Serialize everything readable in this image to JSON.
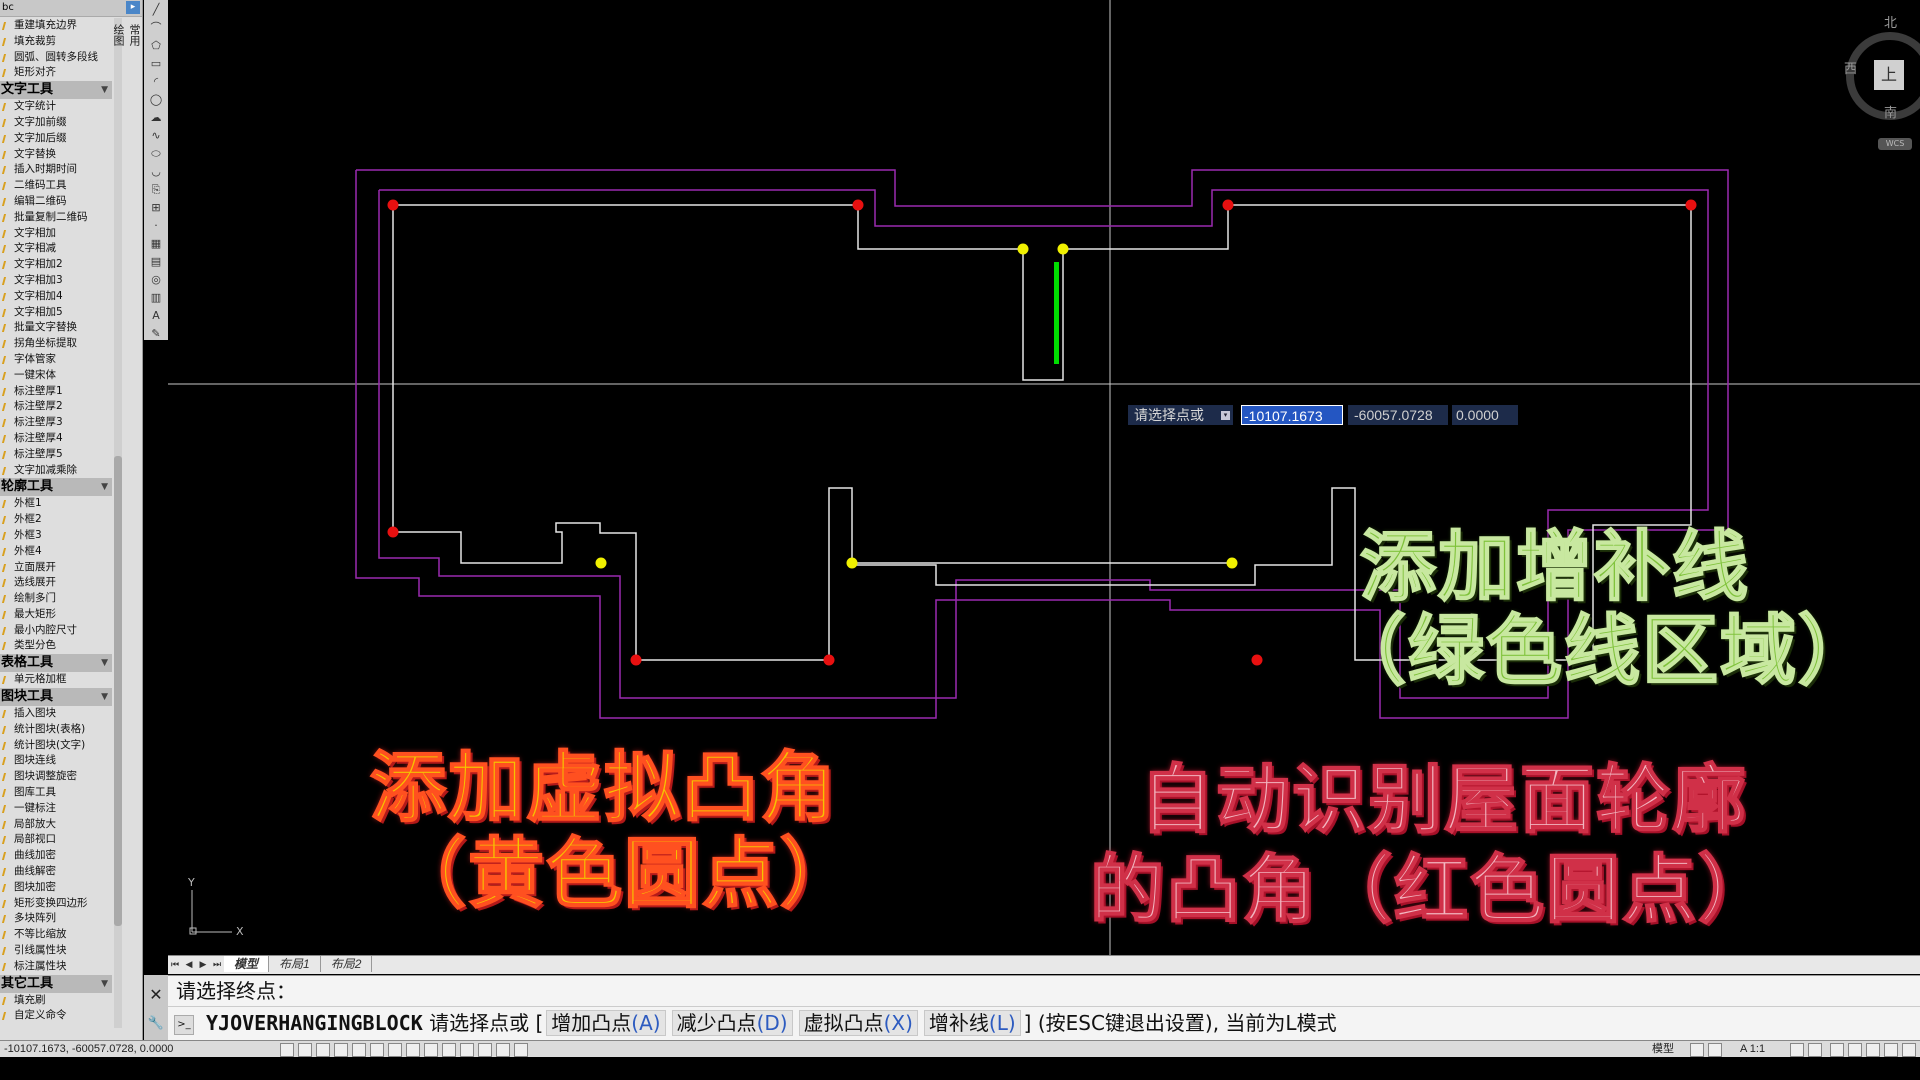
{
  "palette": {
    "top_label": "bc",
    "tabs": [
      "常用",
      "绘图"
    ],
    "groups": [
      {
        "header": null,
        "items": [
          "重建填充边界",
          "填充裁剪",
          "圆弧、圆转多段线",
          "矩形对齐"
        ]
      },
      {
        "header": "文字工具",
        "items": [
          "文字统计",
          "文字加前缀",
          "文字加后缀",
          "文字替换",
          "插入时期时间",
          "二维码工具",
          "编辑二维码",
          "批量复制二维码",
          "文字相加",
          "文字相减",
          "文字相加2",
          "文字相加3",
          "文字相加4",
          "文字相加5",
          "批量文字替换",
          "拐角坐标提取",
          "字体管家",
          "一键宋体",
          "标注壁厚1",
          "标注壁厚2",
          "标注壁厚3",
          "标注壁厚4",
          "标注壁厚5",
          "文字加减乘除"
        ]
      },
      {
        "header": "轮廓工具",
        "items": [
          "外框1",
          "外框2",
          "外框3",
          "外框4",
          "立面展开",
          "选线展开",
          "绘制多门",
          "最大矩形",
          "最小内腔尺寸",
          "类型分色"
        ]
      },
      {
        "header": "表格工具",
        "items": [
          "单元格加框"
        ]
      },
      {
        "header": "图块工具",
        "items": [
          "插入图块",
          "统计图块(表格)",
          "统计图块(文字)",
          "图块连线",
          "图块调整旋密",
          "图库工具",
          "一键标注",
          "局部放大",
          "局部视口",
          "曲线加密",
          "曲线解密",
          "图块加密",
          "矩形变换四边形",
          "多块阵列",
          "不等比缩放",
          "引线属性块",
          "标注属性块"
        ]
      },
      {
        "header": "其它工具",
        "items": [
          "填充刷",
          "自定义命令"
        ]
      }
    ]
  },
  "viewcube": {
    "north": "北",
    "south": "南",
    "west": "西",
    "face": "上",
    "wcs": "WCS"
  },
  "dynamic_input": {
    "prompt": "请选择点或",
    "x": "-10107.1673",
    "y": "-60057.0728",
    "z": "0.0000"
  },
  "overlays": {
    "green_line1": "添加增补线",
    "green_line2": "（绿色线区域）",
    "yellow_line1": "添加虚拟凸角",
    "yellow_line2": "（黄色圆点）",
    "pink_line1": "自动识别屋面轮廓",
    "pink_line2": "的凸角（红色圆点）"
  },
  "ucs": {
    "x": "X",
    "y": "Y"
  },
  "layout_tabs": [
    "模型",
    "布局1",
    "布局2"
  ],
  "command": {
    "history": "请选择终点：",
    "name": "YJOVERHANGINGBLOCK",
    "prompt": "请选择点或 [",
    "options": [
      {
        "label": "增加凸点",
        "key": "(A)"
      },
      {
        "label": "减少凸点",
        "key": "(D)"
      },
      {
        "label": "虚拟凸点",
        "key": "(X)"
      },
      {
        "label": "增补线",
        "key": "(L)"
      }
    ],
    "suffix": "] (按ESC键退出设置), 当前为L模式"
  },
  "status": {
    "coords": "-10107.1673, -60057.0728, 0.0000",
    "model": "模型",
    "scale": "A 1:1"
  },
  "colors": {
    "red_points": "#e81010",
    "yellow_points": "#f0f000",
    "green_line": "#00dd00",
    "purple_outline": "#9a2ab0",
    "white_outline": "#e8e8e8"
  }
}
